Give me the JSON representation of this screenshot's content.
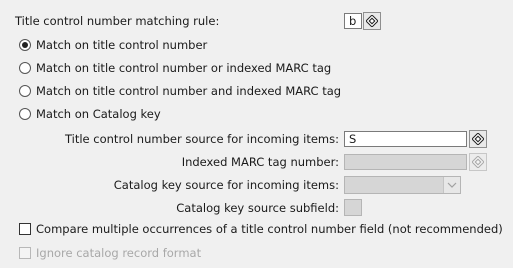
{
  "rule": {
    "label": "Title control number matching rule:",
    "value": "b"
  },
  "options": [
    {
      "label": "Match on title control number",
      "selected": true
    },
    {
      "label": "Match on title control number or indexed MARC tag",
      "selected": false
    },
    {
      "label": "Match on title control number and indexed MARC tag",
      "selected": false
    },
    {
      "label": "Match on Catalog key",
      "selected": false
    }
  ],
  "fields": {
    "tcn_source_label": "Title control number source for incoming items:",
    "tcn_source_value": "S",
    "indexed_marc_label": "Indexed MARC tag number:",
    "indexed_marc_value": "",
    "catkey_source_label": "Catalog key source for incoming items:",
    "catkey_source_value": "",
    "catkey_subfield_label": "Catalog key source subfield:",
    "catkey_subfield_value": ""
  },
  "checkboxes": {
    "compare_multiple_label": "Compare multiple occurrences of a title control number field (not recommended)",
    "compare_multiple_checked": false,
    "ignore_format_label": "Ignore catalog record format",
    "ignore_format_checked": false,
    "ignore_format_enabled": false
  },
  "icons": {
    "gadget": "lookup-gadget-icon",
    "dropdown": "chevron-down-icon"
  }
}
